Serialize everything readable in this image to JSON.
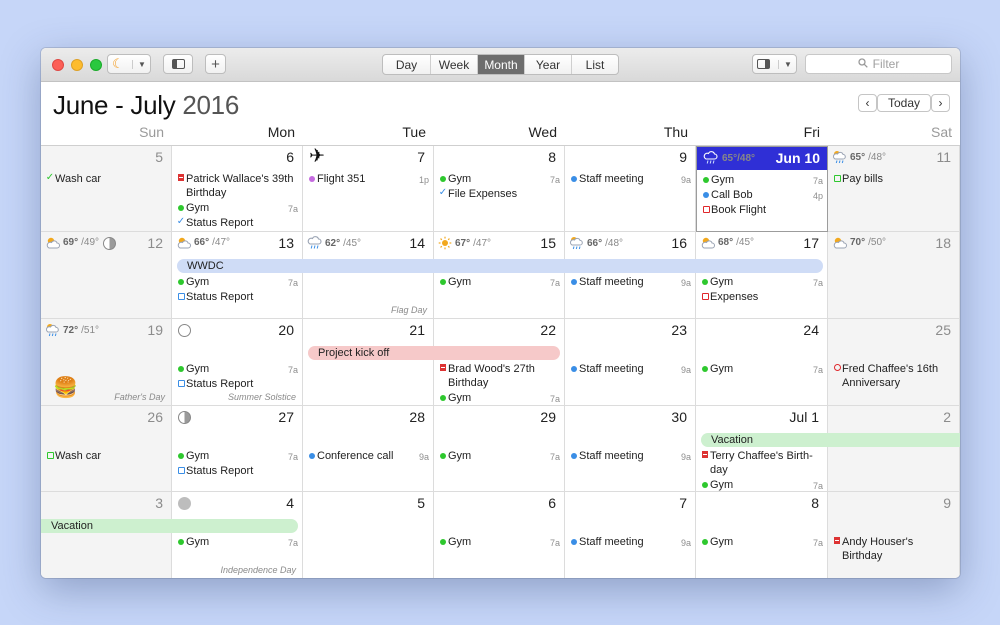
{
  "toolbar": {
    "views": [
      "Day",
      "Week",
      "Month",
      "Year",
      "List"
    ],
    "active_view": "Month",
    "filter_placeholder": "Filter",
    "add_label": "+",
    "today_label": "Today",
    "prev_label": "‹",
    "next_label": "›"
  },
  "header": {
    "title_bold": "June - July",
    "title_year": "2016",
    "days": [
      "Sun",
      "Mon",
      "Tue",
      "Wed",
      "Thu",
      "Fri",
      "Sat"
    ]
  },
  "colors": {
    "today": "#2f2fd6",
    "wwdc_bar": "#cfdcf6",
    "project_bar": "#f6c9c9",
    "vacation_bar": "#cdf0cf",
    "green": "#2ec82e",
    "blue": "#3a8ee6",
    "red": "#e0282c",
    "purple": "#c56be0"
  },
  "weeks": [
    {
      "days": [
        {
          "date": "5",
          "weekend": true,
          "events": [
            {
              "icon": "check",
              "color": "#2ec82e",
              "text": "Wash car",
              "time": ""
            }
          ]
        },
        {
          "date": "6",
          "events": [
            {
              "icon": "cake",
              "color": "#e0282c",
              "text": "Patrick Wallace's 39th Birthday",
              "time": ""
            },
            {
              "icon": "dot",
              "color": "#2ec82e",
              "text": "Gym",
              "time": "7a"
            },
            {
              "icon": "check",
              "color": "#3a8ee6",
              "text": "Status Report",
              "time": ""
            }
          ]
        },
        {
          "date": "7",
          "glyph": "✈",
          "events": [
            {
              "icon": "dot",
              "color": "#c56be0",
              "text": "Flight 351",
              "time": "1p"
            }
          ]
        },
        {
          "date": "8",
          "events": [
            {
              "icon": "dot",
              "color": "#2ec82e",
              "text": "Gym",
              "time": "7a"
            },
            {
              "icon": "check",
              "color": "#3a8ee6",
              "text": "File Expenses",
              "time": ""
            }
          ]
        },
        {
          "date": "9",
          "events": [
            {
              "icon": "dot",
              "color": "#3a8ee6",
              "text": "Staff meeting",
              "time": "9a"
            }
          ]
        },
        {
          "date": "Jun 10",
          "today": true,
          "weather": {
            "hi": "65°",
            "lo": "/48°",
            "icon": "cloud-rain-icon"
          },
          "events": [
            {
              "icon": "dot",
              "color": "#2ec82e",
              "text": "Gym",
              "time": "7a"
            },
            {
              "icon": "dot",
              "color": "#3a8ee6",
              "text": "Call Bob",
              "time": "4p"
            },
            {
              "icon": "square",
              "color": "#e0282c",
              "text": "Book Flight",
              "time": ""
            }
          ]
        },
        {
          "date": "11",
          "weekend": true,
          "weather": {
            "hi": "65°",
            "lo": "/48°",
            "icon": "sun-rain-icon"
          },
          "events": [
            {
              "icon": "square",
              "color": "#2ec82e",
              "text": "Pay bills",
              "time": ""
            }
          ]
        }
      ]
    },
    {
      "bar": {
        "text": "WWDC"
      },
      "days": [
        {
          "date": "12",
          "weekend": true,
          "weather": {
            "hi": "69°",
            "lo": "/49°",
            "icon": "sun-cloud-icon"
          },
          "moon": "half",
          "events": []
        },
        {
          "date": "13",
          "weather": {
            "hi": "66°",
            "lo": "/47°",
            "icon": "sun-cloud-icon"
          },
          "events": [
            {
              "icon": "dot",
              "color": "#2ec82e",
              "text": "Gym",
              "time": "7a"
            },
            {
              "icon": "square",
              "color": "#3a8ee6",
              "text": "Status Report",
              "time": ""
            }
          ]
        },
        {
          "date": "14",
          "weather": {
            "hi": "62°",
            "lo": "/45°",
            "icon": "cloud-rain-icon"
          },
          "note": "Flag Day",
          "events": []
        },
        {
          "date": "15",
          "weather": {
            "hi": "67°",
            "lo": "/47°",
            "icon": "sun-icon"
          },
          "events": [
            {
              "icon": "dot",
              "color": "#2ec82e",
              "text": "Gym",
              "time": "7a"
            }
          ]
        },
        {
          "date": "16",
          "weather": {
            "hi": "66°",
            "lo": "/48°",
            "icon": "sun-rain-icon"
          },
          "events": [
            {
              "icon": "dot",
              "color": "#3a8ee6",
              "text": "Staff meeting",
              "time": "9a"
            }
          ]
        },
        {
          "date": "17",
          "weather": {
            "hi": "68°",
            "lo": "/45°",
            "icon": "sun-cloud-icon"
          },
          "events": [
            {
              "icon": "dot",
              "color": "#2ec82e",
              "text": "Gym",
              "time": "7a"
            },
            {
              "icon": "square",
              "color": "#e0282c",
              "text": "Expenses",
              "time": ""
            }
          ]
        },
        {
          "date": "18",
          "weekend": true,
          "weather": {
            "hi": "70°",
            "lo": "/50°",
            "icon": "sun-cloud-icon"
          },
          "events": []
        }
      ]
    },
    {
      "bar": {
        "text": "Project kick off"
      },
      "days": [
        {
          "date": "19",
          "weekend": true,
          "weather": {
            "hi": "72°",
            "lo": "/51°",
            "icon": "sun-rain-icon"
          },
          "burger": "🍔",
          "note": "Father's Day",
          "events": []
        },
        {
          "date": "20",
          "moon": "new",
          "note": "Summer Solstice",
          "events": [
            {
              "icon": "dot",
              "color": "#2ec82e",
              "text": "Gym",
              "time": "7a"
            },
            {
              "icon": "square",
              "color": "#3a8ee6",
              "text": "Status Report",
              "time": ""
            }
          ]
        },
        {
          "date": "21",
          "events": []
        },
        {
          "date": "22",
          "events": [
            {
              "icon": "cake",
              "color": "#e0282c",
              "text": "Brad Wood's 27th Birthday",
              "time": ""
            },
            {
              "icon": "dot",
              "color": "#2ec82e",
              "text": "Gym",
              "time": "7a"
            }
          ]
        },
        {
          "date": "23",
          "events": [
            {
              "icon": "dot",
              "color": "#3a8ee6",
              "text": "Staff meeting",
              "time": "9a"
            }
          ]
        },
        {
          "date": "24",
          "events": [
            {
              "icon": "dot",
              "color": "#2ec82e",
              "text": "Gym",
              "time": "7a"
            }
          ]
        },
        {
          "date": "25",
          "weekend": true,
          "events": [
            {
              "icon": "ring",
              "color": "#e0282c",
              "text": "Fred Chaffee's 16th Anniversary",
              "time": ""
            }
          ]
        }
      ]
    },
    {
      "bar": {
        "text": "Vacation"
      },
      "days": [
        {
          "date": "26",
          "weekend": true,
          "events": [
            {
              "icon": "square",
              "color": "#2ec82e",
              "text": "Wash car",
              "time": ""
            }
          ]
        },
        {
          "date": "27",
          "moon": "half",
          "events": [
            {
              "icon": "dot",
              "color": "#2ec82e",
              "text": "Gym",
              "time": "7a"
            },
            {
              "icon": "square",
              "color": "#3a8ee6",
              "text": "Status Report",
              "time": ""
            }
          ]
        },
        {
          "date": "28",
          "events": [
            {
              "icon": "dot",
              "color": "#3a8ee6",
              "text": "Conference call",
              "time": "9a"
            }
          ]
        },
        {
          "date": "29",
          "events": [
            {
              "icon": "dot",
              "color": "#2ec82e",
              "text": "Gym",
              "time": "7a"
            }
          ]
        },
        {
          "date": "30",
          "events": [
            {
              "icon": "dot",
              "color": "#3a8ee6",
              "text": "Staff meeting",
              "time": "9a"
            }
          ]
        },
        {
          "date": "Jul 1",
          "events": [
            {
              "icon": "cake",
              "color": "#e0282c",
              "text": "Terry Chaffee's Birth-day",
              "time": ""
            },
            {
              "icon": "dot",
              "color": "#2ec82e",
              "text": "Gym",
              "time": "7a"
            }
          ]
        },
        {
          "date": "2",
          "weekend": true,
          "events": []
        }
      ]
    },
    {
      "bar": {
        "text": "Vacation"
      },
      "days": [
        {
          "date": "3",
          "weekend": true,
          "events": []
        },
        {
          "date": "4",
          "moon": "full",
          "note": "Independence Day",
          "events": [
            {
              "icon": "dot",
              "color": "#2ec82e",
              "text": "Gym",
              "time": "7a"
            }
          ]
        },
        {
          "date": "5",
          "events": []
        },
        {
          "date": "6",
          "events": [
            {
              "icon": "dot",
              "color": "#2ec82e",
              "text": "Gym",
              "time": "7a"
            }
          ]
        },
        {
          "date": "7",
          "events": [
            {
              "icon": "dot",
              "color": "#3a8ee6",
              "text": "Staff meeting",
              "time": "9a"
            }
          ]
        },
        {
          "date": "8",
          "events": [
            {
              "icon": "dot",
              "color": "#2ec82e",
              "text": "Gym",
              "time": "7a"
            }
          ]
        },
        {
          "date": "9",
          "weekend": true,
          "events": [
            {
              "icon": "cake",
              "color": "#e0282c",
              "text": "Andy Houser's Birthday",
              "time": ""
            }
          ]
        }
      ]
    }
  ]
}
